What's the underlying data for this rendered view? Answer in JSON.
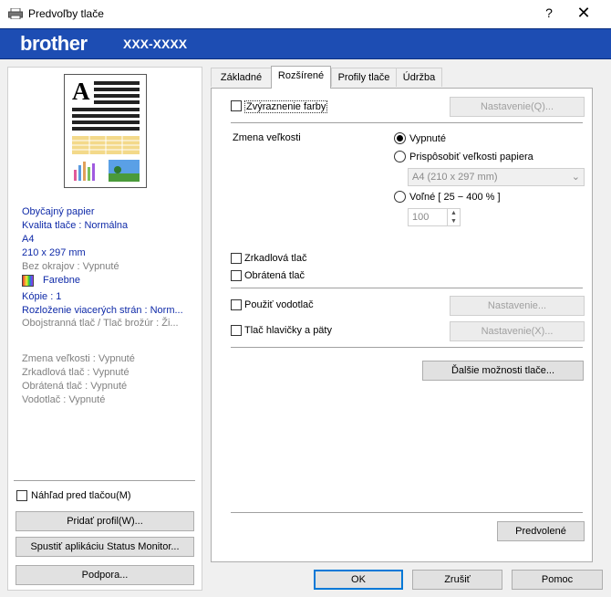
{
  "window": {
    "title": "Predvoľby tlače",
    "help": "?",
    "close": "✕"
  },
  "banner": {
    "logo": "brother",
    "model": "XXX-XXXX"
  },
  "summary": {
    "paper_type": "Obyčajný papier",
    "quality": "Kvalita tlače : Normálna",
    "paper_size": "A4",
    "dimensions": "210 x 297 mm",
    "borderless": "Bez okrajov : Vypnuté",
    "color_mode": "Farebne",
    "copies": "Kópie : 1",
    "layout": "Rozloženie viacerých strán : Norm...",
    "duplex": "Obojstranná tlač / Tlač brožúr : Ži...",
    "scaling": "Zmena veľkosti : Vypnuté",
    "mirror": "Zrkadlová tlač : Vypnuté",
    "reverse": "Obrátená tlač : Vypnuté",
    "watermark": "Vodotlač : Vypnuté"
  },
  "left_controls": {
    "print_preview": "Náhľad pred tlačou(M)",
    "add_profile": "Pridať profil(W)...",
    "status_monitor": "Spustiť aplikáciu Status Monitor...",
    "support": "Podpora..."
  },
  "tabs": [
    {
      "label": "Základné",
      "active": false
    },
    {
      "label": "Rozšírené",
      "active": true
    },
    {
      "label": "Profily tlače",
      "active": false
    },
    {
      "label": "Údržba",
      "active": false
    }
  ],
  "advanced": {
    "enhance_color": "Zvýraznenie farby",
    "enhance_settings": "Nastavenie(Q)...",
    "scaling_label": "Zmena veľkosti",
    "scaling_off": "Vypnuté",
    "fit_to_paper": "Prispôsobiť veľkosti papiera",
    "paper_select": "A4 (210 x 297 mm)",
    "free_scale": "Voľné [ 25 − 400 % ]",
    "free_scale_value": "100",
    "mirror_print": "Zrkadlová tlač",
    "reverse_print": "Obrátená tlač",
    "use_watermark": "Použiť vodotlač",
    "watermark_settings": "Nastavenie...",
    "header_footer": "Tlač hlavičky a päty",
    "header_footer_settings": "Nastavenie(X)...",
    "more_options": "Ďalšie možnosti tlače...",
    "defaults": "Predvolené"
  },
  "footer": {
    "ok": "OK",
    "cancel": "Zrušiť",
    "help": "Pomoc"
  },
  "colors": {
    "banner": "#1d4db3",
    "summary_text": "#0f2aa8",
    "focus": "#0078d7"
  }
}
